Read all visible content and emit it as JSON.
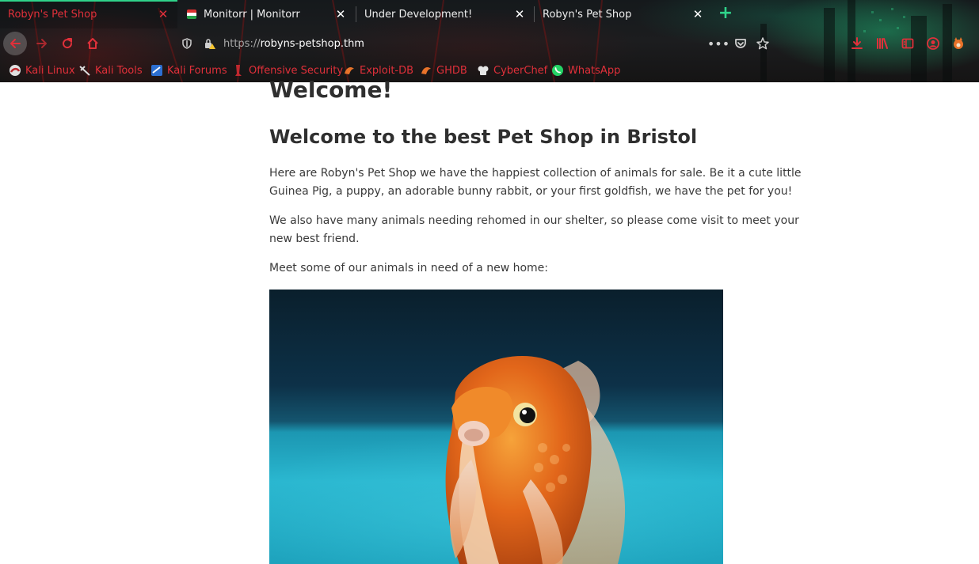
{
  "browser": {
    "tabs": [
      {
        "title": "Robyn's Pet Shop",
        "active": true
      },
      {
        "title": "Monitorr | Monitorr",
        "active": false
      },
      {
        "title": "Under Development!",
        "active": false
      },
      {
        "title": "Robyn's Pet Shop",
        "active": false
      }
    ],
    "url_scheme": "https://",
    "url_host": "robyns-petshop.thm",
    "bookmarks": [
      {
        "label": "Kali Linux",
        "icon": "kali-linux-icon"
      },
      {
        "label": "Kali Tools",
        "icon": "kali-tools-icon"
      },
      {
        "label": "Kali Forums",
        "icon": "kali-forums-icon"
      },
      {
        "label": "Offensive Security",
        "icon": "offensive-security-icon"
      },
      {
        "label": "Exploit-DB",
        "icon": "exploit-db-icon"
      },
      {
        "label": "GHDB",
        "icon": "ghdb-icon"
      },
      {
        "label": "CyberChef",
        "icon": "cyberchef-icon"
      },
      {
        "label": "WhatsApp",
        "icon": "whatsapp-icon"
      }
    ],
    "accent_color": "#e0303a",
    "tab_highlight_color": "#2fd38a"
  },
  "page": {
    "heading": "Welcome!",
    "subheading": "Welcome to the best Pet Shop in Bristol",
    "paragraph1": "Here are Robyn's Pet Shop we have the happiest collection of animals for sale. Be it a cute little Guinea Pig, a puppy, an adorable bunny rabbit, or your first goldfish, we have the pet for you!",
    "paragraph2": "We also have many animals needing rehomed in our shelter, so please come visit to meet your new best friend.",
    "paragraph3": "Meet some of our animals in need of a new home:",
    "image_subject": "goldfish"
  }
}
